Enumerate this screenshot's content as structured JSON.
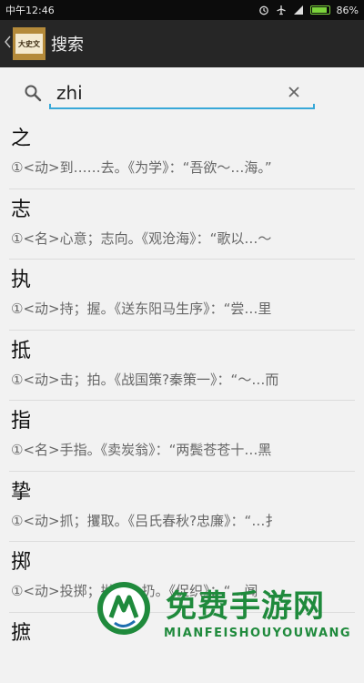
{
  "status_bar": {
    "time": "中午12:46",
    "battery": "86%",
    "battery_level": 0.86
  },
  "action_bar": {
    "back_icon": "chevron-left-icon",
    "logo_text": "大史文",
    "title": "搜索"
  },
  "search": {
    "icon": "search-icon",
    "value": "zhi",
    "clear_icon": "close-icon",
    "accent_color": "#38a8d8"
  },
  "results": [
    {
      "char": "之",
      "definition": "①<动>到……去。《为学》：“吾欲～…海。”"
    },
    {
      "char": "志",
      "definition": "①<名>心意；志向。《观沧海》：“歌以…～"
    },
    {
      "char": "执",
      "definition": "①<动>持；握。《送东阳马生序》：“尝…里"
    },
    {
      "char": "抵",
      "definition": "①<动>击；拍。《战国策?秦策一》：“～…而"
    },
    {
      "char": "指",
      "definition": "①<名>手指。《卖炭翁》：“两鬓苍苍十…黑"
    },
    {
      "char": "挚",
      "definition": "①<动>抓；攫取。《吕氏春秋?忠廉》：“…扌"
    },
    {
      "char": "掷",
      "definition": "①<动>投掷；抛掷；扔。《促织》：“…闻"
    },
    {
      "char": "摭",
      "definition": ""
    }
  ],
  "watermark": {
    "title": "免费手游网",
    "subtitle": "MIANFEISHOUYOUWANG",
    "color": "#1f8a3c"
  }
}
